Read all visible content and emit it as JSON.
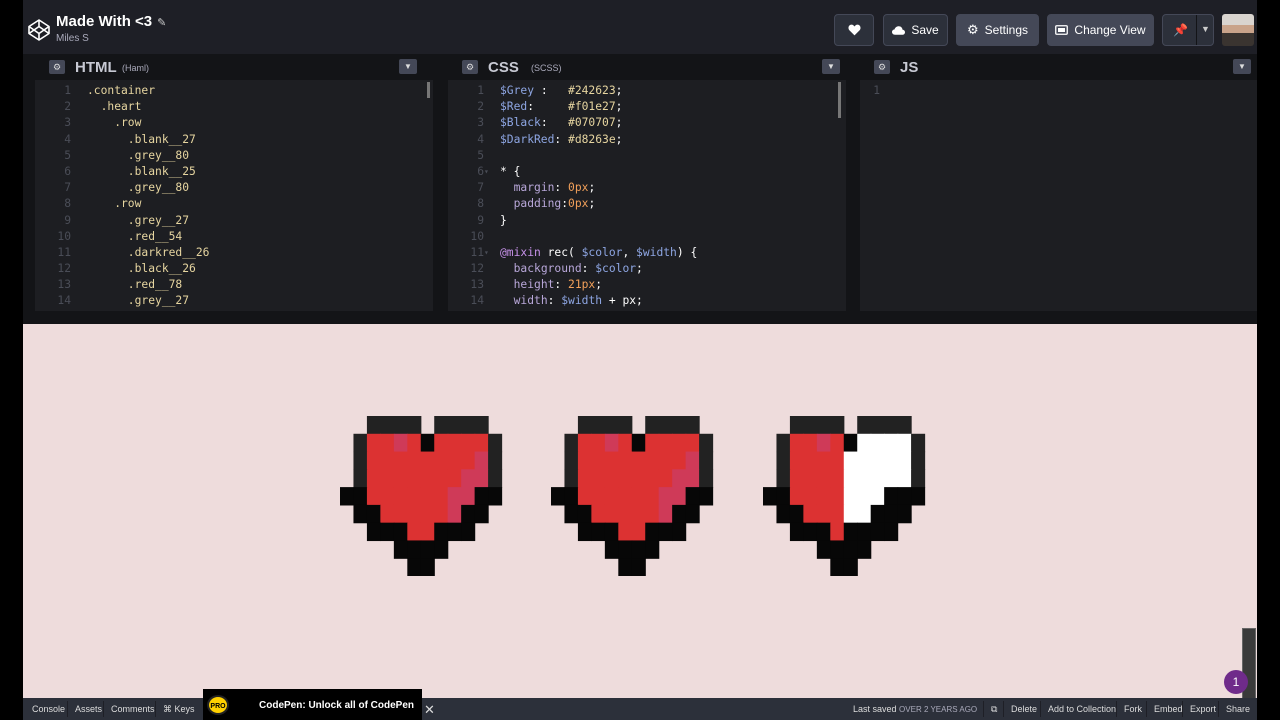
{
  "header": {
    "title": "Made With <3",
    "author": "Miles S",
    "save_label": "Save",
    "settings_label": "Settings",
    "change_view_label": "Change View"
  },
  "html_pane": {
    "lang": "HTML",
    "preprocessor": "(Haml)",
    "lines": [
      ".container",
      "  .heart",
      "    .row",
      "      .blank__27",
      "      .grey__80",
      "      .blank__25",
      "      .grey__80",
      "    .row",
      "      .grey__27",
      "      .red__54",
      "      .darkred__26",
      "      .black__26",
      "      .red__78",
      "      .grey__27"
    ]
  },
  "css_pane": {
    "lang": "CSS",
    "preprocessor": "(SCSS)"
  },
  "js_pane": {
    "lang": "JS",
    "line_number": "1"
  },
  "footer": {
    "console": "Console",
    "assets": "Assets",
    "comments": "Comments",
    "keys": "⌘ Keys",
    "promo_badge": "PRO",
    "promo_text": "CodePen: Unlock all of CodePen",
    "last_saved_label": "Last saved",
    "last_saved_when": "OVER 2 YEARS AGO",
    "delete": "Delete",
    "add_to_collection": "Add to Collection",
    "fork": "Fork",
    "embed": "Embed",
    "export": "Export",
    "share": "Share"
  },
  "notification_count": "1",
  "colors": {
    "grey": "#242623",
    "red": "#f01e27",
    "black": "#070707",
    "darkred": "#d8263e",
    "preview_bg": "#eedcdc"
  }
}
